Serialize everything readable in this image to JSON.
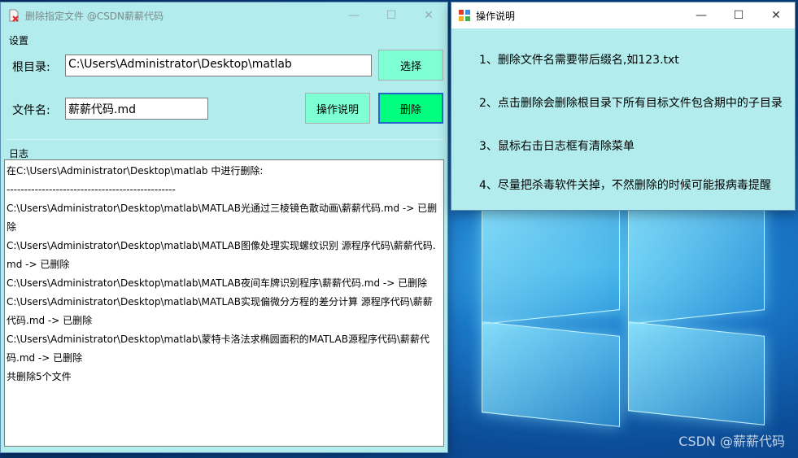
{
  "main_window": {
    "title": "删除指定文件 @CSDN薪薪代码",
    "controls": {
      "minimize": "—",
      "maximize": "☐",
      "close": "✕"
    },
    "settings_group": "设置",
    "root_dir_label": "根目录:",
    "root_dir_value": "C:\\Users\\Administrator\\Desktop\\matlab",
    "select_button": "选择",
    "file_name_label": "文件名:",
    "file_name_value": "薪薪代码.md",
    "help_button": "操作说明",
    "delete_button": "删除",
    "log_group": "日志",
    "log_lines": [
      "在C:\\Users\\Administrator\\Desktop\\matlab 中进行删除:",
      "------------------------------------------------",
      "C:\\Users\\Administrator\\Desktop\\matlab\\MATLAB光通过三棱镜色散动画\\薪薪代码.md -> 已删除",
      "C:\\Users\\Administrator\\Desktop\\matlab\\MATLAB图像处理实现螺纹识别 源程序代码\\薪薪代码.md -> 已删除",
      "C:\\Users\\Administrator\\Desktop\\matlab\\MATLAB夜间车牌识别程序\\薪薪代码.md -> 已删除",
      "C:\\Users\\Administrator\\Desktop\\matlab\\MATLAB实现偏微分方程的差分计算 源程序代码\\薪薪代码.md -> 已删除",
      "C:\\Users\\Administrator\\Desktop\\matlab\\蒙特卡洛法求椭圆面积的MATLAB源程序代码\\薪薪代码.md -> 已删除",
      "共删除5个文件"
    ]
  },
  "help_window": {
    "title": "操作说明",
    "controls": {
      "minimize": "—",
      "maximize": "☐",
      "close": "✕"
    },
    "items": [
      "1、删除文件名需要带后缀名,如123.txt",
      "2、点击删除会删除根目录下所有目标文件包含期中的子目录",
      "3、鼠标右击日志框有清除菜单",
      "4、尽量把杀毒软件关掉，不然删除的时候可能报病毒提醒"
    ]
  },
  "watermark": "CSDN @薪薪代码"
}
